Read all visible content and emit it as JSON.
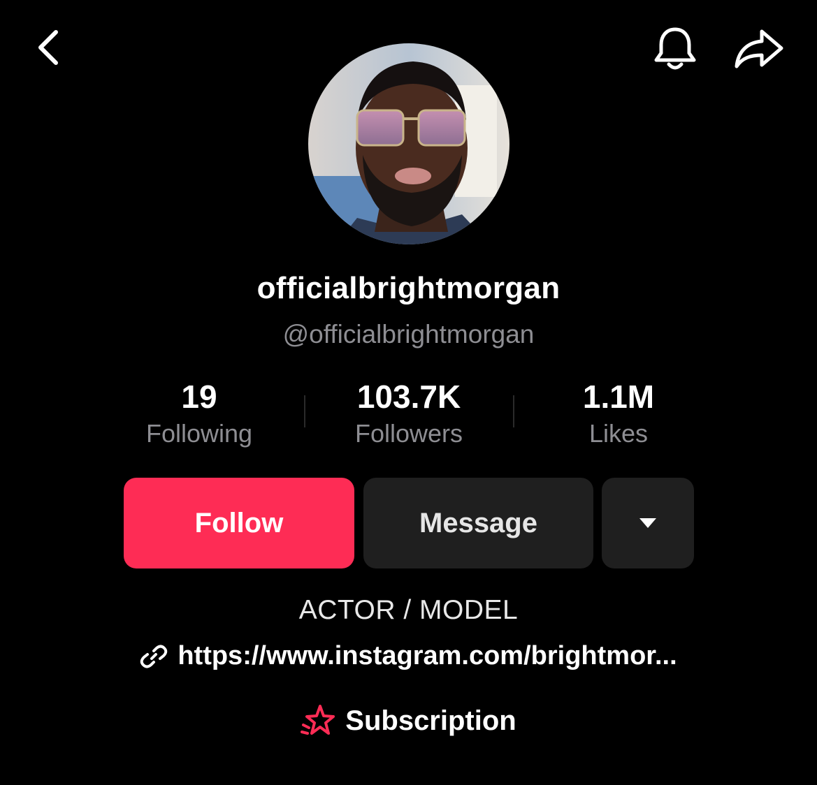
{
  "header": {
    "back_icon": "chevron-left-icon",
    "bell_icon": "bell-icon",
    "share_icon": "share-arrow-icon"
  },
  "profile": {
    "display_name": "officialbrightmorgan",
    "handle": "@officialbrightmorgan",
    "bio": "ACTOR / MODEL",
    "link": "https://www.instagram.com/brightmor..."
  },
  "stats": [
    {
      "value": "19",
      "label": "Following"
    },
    {
      "value": "103.7K",
      "label": "Followers"
    },
    {
      "value": "1.1M",
      "label": "Likes"
    }
  ],
  "actions": {
    "follow_label": "Follow",
    "message_label": "Message",
    "more_icon": "caret-down-icon"
  },
  "subscription": {
    "label": "Subscription",
    "icon": "star-subscription-icon"
  },
  "colors": {
    "background": "#000000",
    "accent": "#fe2c55",
    "secondary_button": "#1f1f1f",
    "muted_text": "#8e8e93"
  }
}
